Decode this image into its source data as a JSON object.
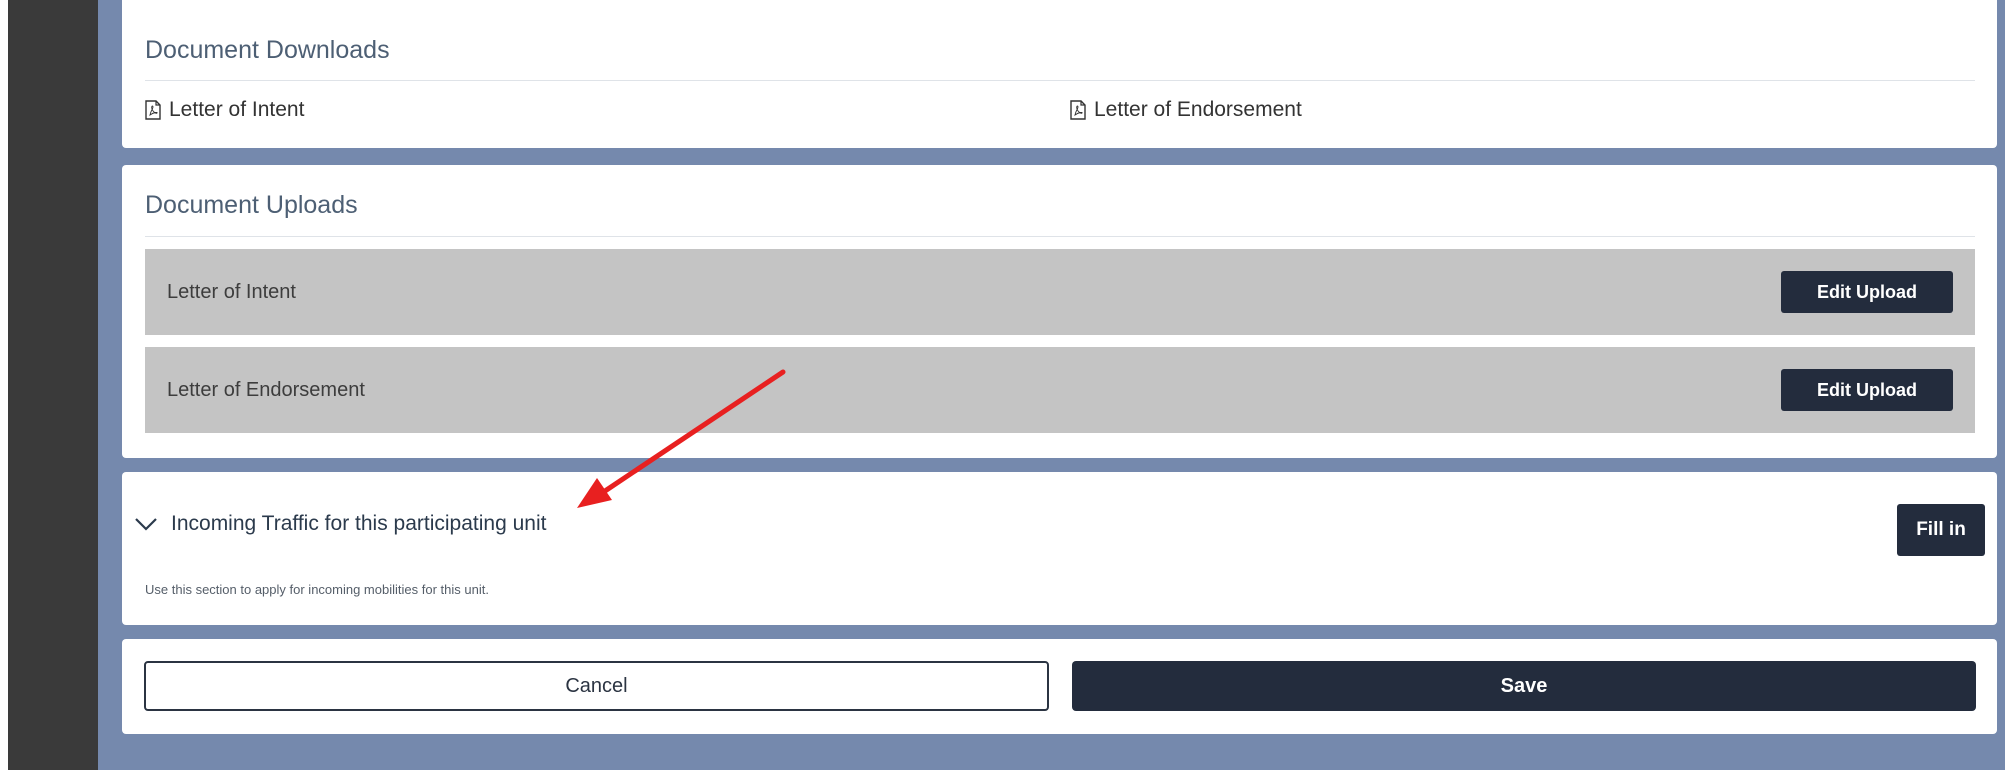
{
  "document_downloads": {
    "title": "Document Downloads",
    "items": [
      {
        "label": "Letter of Intent",
        "icon": "pdf-file-icon"
      },
      {
        "label": "Letter of Endorsement",
        "icon": "pdf-file-icon"
      }
    ]
  },
  "document_uploads": {
    "title": "Document Uploads",
    "rows": [
      {
        "label": "Letter of Intent",
        "button_label": "Edit Upload"
      },
      {
        "label": "Letter of Endorsement",
        "button_label": "Edit Upload"
      }
    ]
  },
  "incoming_traffic": {
    "title": "Incoming Traffic for this participating unit",
    "description": "Use this section to apply for incoming mobilities for this unit.",
    "fill_in_label": "Fill in",
    "toggle_icon": "chevron-down-icon"
  },
  "actions": {
    "cancel_label": "Cancel",
    "save_label": "Save"
  },
  "annotation": {
    "color": "#e82020",
    "icon": "red-arrow-annotation"
  },
  "colors": {
    "accent_dark": "#232c3d",
    "page_background": "#7589ad",
    "upload_row": "#c4c4c4",
    "sidebar": "#3a3a3a"
  }
}
